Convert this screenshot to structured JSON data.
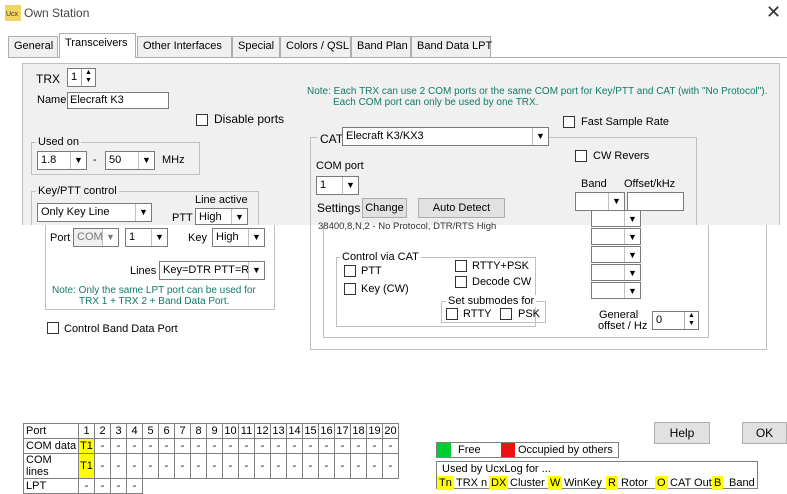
{
  "window": {
    "title": "Own Station",
    "app_icon_text": "Ucx"
  },
  "tabs": [
    "General",
    "Transceivers",
    "Other Interfaces",
    "Special",
    "Colors / QSL",
    "Band Plan",
    "Band Data LPT"
  ],
  "trx": {
    "label": "TRX",
    "value": "1",
    "name_label": "Name",
    "name_value": "Elecraft K3",
    "note1": "Note: Each TRX can use 2 COM ports or the same COM port for Key/PTT and CAT (with \"No Protocol\").",
    "note2": "Each COM port can only be used by one TRX."
  },
  "disable_ports": "Disable ports",
  "used_on": {
    "legend": "Used on",
    "from": "1.8",
    "dash": "-",
    "to": "50",
    "unit": "MHz"
  },
  "key_ptt": {
    "legend": "Key/PTT control",
    "mode": "Only Key Line",
    "line_active": "Line active",
    "ptt_label": "PTT",
    "ptt_value": "High",
    "port_label": "Port",
    "port_value": "COM",
    "port_num": "1",
    "key_label": "Key",
    "key_value": "High",
    "lines_label": "Lines",
    "lines_value": "Key=DTR PTT=RTS",
    "note1": "Note: Only the same LPT port can be used for",
    "note2": "TRX 1 + TRX 2 + Band Data Port."
  },
  "control_band_data_port": "Control Band Data Port",
  "cat": {
    "label": "CAT",
    "value": "Elecraft K3/KX3",
    "com_port_label": "COM port",
    "com_port_value": "1",
    "settings_label": "Settings",
    "change": "Change",
    "auto_detect": "Auto Detect",
    "settings_value": "38400,8,N,2 - No Protocol, DTR/RTS High"
  },
  "control_via_cat": {
    "legend": "Control via CAT",
    "ptt": "PTT",
    "key_cw": "Key (CW)",
    "rtty_psk": "RTTY+PSK",
    "decode_cw": "Decode CW",
    "submodes_legend": "Set submodes for",
    "rtty": "RTTY",
    "psk": "PSK"
  },
  "fast_sample_rate": "Fast Sample Rate",
  "cw_revers": "CW Revers",
  "band_label": "Band",
  "offset_label": "Offset/kHz",
  "general_offset": {
    "line1": "General",
    "line2": "offset / Hz",
    "value": "0"
  },
  "ports_table": {
    "header": "Port",
    "columns": [
      "1",
      "2",
      "3",
      "4",
      "5",
      "6",
      "7",
      "8",
      "9",
      "10",
      "11",
      "12",
      "13",
      "14",
      "15",
      "16",
      "17",
      "18",
      "19",
      "20"
    ],
    "rows": [
      {
        "name": "COM data",
        "cells": [
          "T1",
          "-",
          "-",
          "-",
          "-",
          "-",
          "-",
          "-",
          "-",
          "-",
          "-",
          "-",
          "-",
          "-",
          "-",
          "-",
          "-",
          "-",
          "-",
          "-"
        ]
      },
      {
        "name": "COM lines",
        "cells": [
          "T1",
          "-",
          "-",
          "-",
          "-",
          "-",
          "-",
          "-",
          "-",
          "-",
          "-",
          "-",
          "-",
          "-",
          "-",
          "-",
          "-",
          "-",
          "-",
          "-"
        ]
      },
      {
        "name": "LPT",
        "cells": [
          "-",
          "-",
          "-",
          "-"
        ]
      }
    ]
  },
  "legend_free": "Free",
  "legend_occupied": "Occupied by others",
  "used_by": {
    "title": "Used by UcxLog for ...",
    "items": [
      [
        "Tn",
        "TRX n"
      ],
      [
        "DX",
        "Cluster"
      ],
      [
        "W",
        "WinKey"
      ],
      [
        "R",
        "Rotor"
      ],
      [
        "O",
        "CAT Out"
      ],
      [
        "B",
        "Band"
      ]
    ]
  },
  "buttons": {
    "help": "Help",
    "ok": "OK"
  },
  "colors": {
    "free": "#00cc33",
    "occupied": "#ee1111",
    "highlight": "#ffff00",
    "note": "#117a6a"
  }
}
